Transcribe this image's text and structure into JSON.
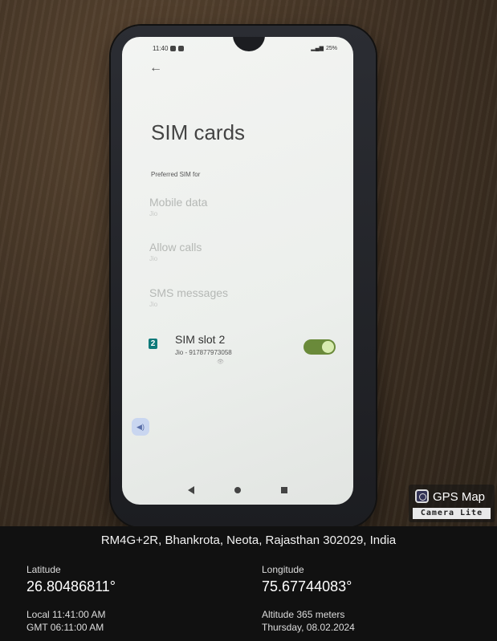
{
  "phone": {
    "status_time": "11:40",
    "battery": "25%",
    "screen_title": "SIM cards",
    "section_label": "Preferred SIM for",
    "preferences": [
      {
        "title": "Mobile data",
        "subtitle": "Jio"
      },
      {
        "title": "Allow calls",
        "subtitle": "Jio"
      },
      {
        "title": "SMS messages",
        "subtitle": "Jio"
      }
    ],
    "sim_slot": {
      "number": "2",
      "title": "SIM slot 2",
      "subtitle": "Jio - 917877973058",
      "enabled": true
    },
    "icons": {
      "back": "back-arrow-icon",
      "nav_back": "nav-back-icon",
      "nav_home": "nav-home-icon",
      "nav_recent": "nav-recent-icon"
    }
  },
  "badge": {
    "title": "GPS Map",
    "subtitle": "Camera Lite"
  },
  "info": {
    "address": "RM4G+2R, Bhankrota, Neota, Rajasthan 302029, India",
    "latitude_label": "Latitude",
    "latitude": "26.80486811°",
    "longitude_label": "Longitude",
    "longitude": "75.67744083°",
    "local_time": "Local 11:41:00 AM",
    "gmt_time": "GMT 06:11:00 AM",
    "altitude": "Altitude 365 meters",
    "date": "Thursday, 08.02.2024"
  },
  "colors": {
    "toggle_on": "#6a8a3a",
    "sim_badge": "#0f7a7a",
    "info_bg": "#111111"
  }
}
